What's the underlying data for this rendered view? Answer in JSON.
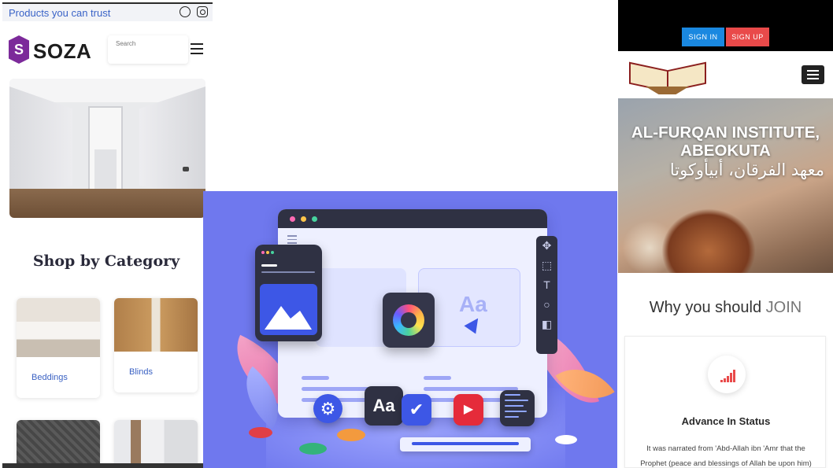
{
  "left_site": {
    "tagline": "Products you can trust",
    "brand": "SOZA",
    "logo_letter": "S",
    "search_placeholder": "Search",
    "section_heading": "Shop by Category",
    "categories": [
      {
        "label": "Beddings"
      },
      {
        "label": "Blinds"
      }
    ],
    "icons": [
      "whatsapp-icon",
      "instagram-icon",
      "menu-icon"
    ]
  },
  "middle_illustration": {
    "aa_label": "Aa",
    "toolbar_icons": [
      "move-icon",
      "select-icon",
      "text-icon",
      "zoom-icon",
      "layers-icon"
    ],
    "colors": {
      "background": "#6f78ee",
      "dark_panel": "#2f3143",
      "accent_blue": "#3d57e6",
      "play_red": "#e52b3a"
    }
  },
  "right_site": {
    "sign_in": "SIGN IN",
    "sign_up": "SIGN UP",
    "banner_title_line1": "AL-FURQAN INSTITUTE,",
    "banner_title_line2": "ABEOKUTA",
    "banner_arabic": "معهد الفرقان، أبيأوكوتا",
    "why_prefix": "Why you should",
    "why_accent": "JOIN",
    "feature_title": "Advance In Status",
    "feature_text_line1": "It was narrated from 'Abd-Allah ibn 'Amr that the",
    "feature_text_line2": "Prophet (peace and blessings of Allah be upon him)",
    "colors": {
      "sign_in": "#1a88e0",
      "sign_up": "#e94a4a",
      "icon_accent": "#e94a4a"
    }
  }
}
